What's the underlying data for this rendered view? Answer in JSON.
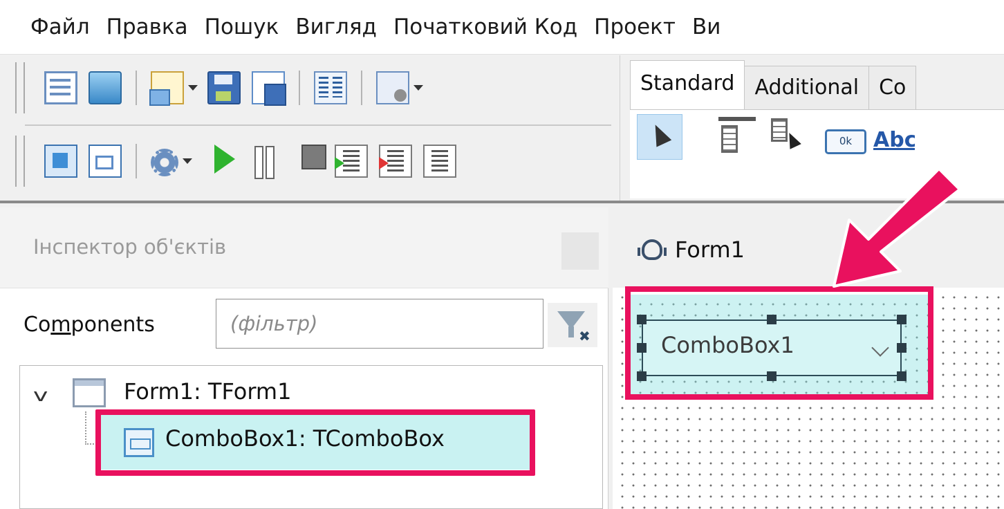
{
  "menu": [
    {
      "label": "Файл"
    },
    {
      "label": "Правка"
    },
    {
      "label": "Пошук"
    },
    {
      "label": "Вигляд"
    },
    {
      "label": "Початковий Код"
    },
    {
      "label": "Проект"
    },
    {
      "label": "Ви"
    }
  ],
  "palette": {
    "tabs": [
      {
        "label": "Standard",
        "active": true
      },
      {
        "label": "Additional",
        "active": false
      },
      {
        "label": "Co",
        "active": false
      }
    ],
    "button_caption": "0k",
    "label_caption": "Abc"
  },
  "inspector": {
    "title": "Інспектор об'єктів",
    "components_label": "Components",
    "filter_placeholder": "(фільтр)",
    "tree": [
      {
        "label": "Form1: TForm1",
        "expanded": true
      },
      {
        "label": "ComboBox1: TComboBox",
        "selected": true
      }
    ]
  },
  "designer": {
    "form_title": "Form1",
    "combobox_text": "ComboBox1"
  },
  "colors": {
    "highlight": "#e9115e",
    "selection": "#c9f2f2",
    "run_green": "#2fb32f"
  }
}
